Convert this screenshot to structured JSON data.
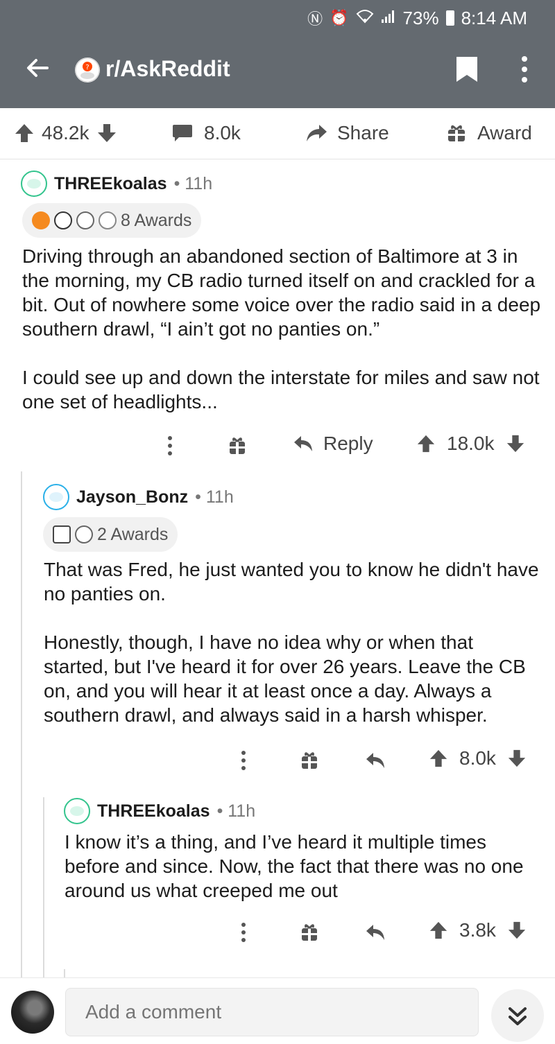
{
  "status_bar": {
    "battery": "73%",
    "time": "8:14 AM"
  },
  "app_bar": {
    "subreddit": "r/AskReddit"
  },
  "post_actions": {
    "upvotes": "48.2k",
    "comments": "8.0k",
    "share": "Share",
    "award": "Award"
  },
  "comments": [
    {
      "username": "THREEkoalas",
      "age": "• 11h",
      "awards_label": "8 Awards",
      "body": [
        "Driving through an abandoned section of Baltimore at 3 in the morning, my CB radio turned itself on and crackled for a bit. Out of nowhere some voice over the radio said in a deep southern drawl, “I ain’t got no panties on.”",
        "I could see up and down the interstate for miles and saw not one set of headlights..."
      ],
      "reply_label": "Reply",
      "score": "18.0k"
    },
    {
      "username": "Jayson_Bonz",
      "age": "• 11h",
      "awards_label": "2 Awards",
      "body": [
        "That was Fred, he just wanted you to know he didn't have no panties on.",
        "Honestly, though, I have no idea why or when that started, but I've heard it for over 26 years. Leave the CB on, and you will hear it at least once a day. Always a southern drawl, and always said in a harsh whisper."
      ],
      "score": "8.0k"
    },
    {
      "username": "THREEkoalas",
      "age": "• 11h",
      "body": [
        "I know it’s a thing, and I’ve heard it multiple times before and since. Now, the fact that there was no one around us what creeped me out"
      ],
      "score": "3.8k"
    }
  ],
  "bottom_bar": {
    "placeholder": "Add a comment"
  },
  "colors": {
    "header": "#646a70",
    "thread_line": "#dcdcdc",
    "snoo_blue": "#2ab0e8",
    "snoo_green": "#33c48d"
  }
}
